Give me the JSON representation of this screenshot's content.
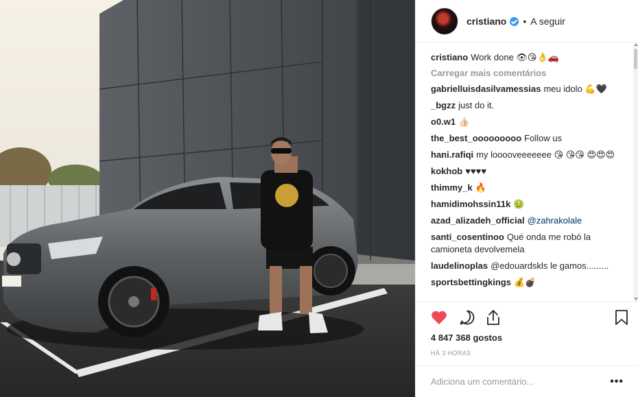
{
  "header": {
    "username": "cristiano",
    "separator": "•",
    "follow_label": "A seguir"
  },
  "caption": {
    "username": "cristiano",
    "text": "Work done 👁😘👌🚗"
  },
  "load_more": "Carregar mais comentários",
  "comments": [
    {
      "user": "gabrielluisdasilvamessias",
      "text": "meu idolo 💪🖤"
    },
    {
      "user": "_bgzz",
      "text": "just do it."
    },
    {
      "user": "o0.w1",
      "text": "👍🏻"
    },
    {
      "user": "the_best_ooooooooo",
      "text": "Follow us"
    },
    {
      "user": "hani.rafiqi",
      "text": "my looooveeeeeee 😘 😘😘 😍😍😍"
    },
    {
      "user": "kokhob",
      "text": "♥♥♥♥"
    },
    {
      "user": "thimmy_k",
      "text": "🔥"
    },
    {
      "user": "hamidimohssin11k",
      "text": "🤢"
    },
    {
      "user": "azad_alizadeh_official",
      "text": "@zahrakolale"
    },
    {
      "user": "santi_cosentinoo",
      "text": "Qué onda me robó la camioneta devolvemela"
    },
    {
      "user": "laudelinoplas",
      "text": "@edouardskls le gamos........."
    },
    {
      "user": "sportsbettingkings",
      "text": "💰💣"
    }
  ],
  "likes": "4 847 368 gostos",
  "time": "HÁ 3 HORAS",
  "comment_input": {
    "placeholder": "Adiciona um comentário..."
  },
  "icons": {
    "like": "heart-icon",
    "comment": "comment-icon",
    "share": "share-icon",
    "save": "bookmark-icon",
    "options": "more-options-icon",
    "verified": "verified-badge-icon"
  },
  "colors": {
    "like_red": "#ed4956",
    "verified_blue": "#3897f0",
    "text": "#262626",
    "muted": "#999999"
  }
}
